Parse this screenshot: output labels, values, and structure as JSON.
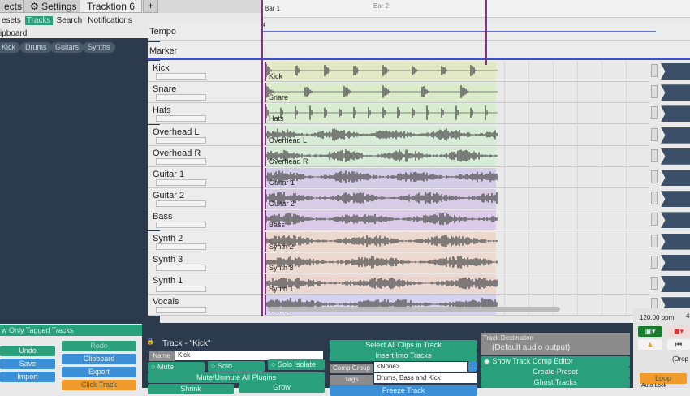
{
  "tabs": [
    {
      "label": "ects"
    },
    {
      "label": "Settings",
      "icon": "gear-icon"
    },
    {
      "label": "Tracktion 6"
    },
    {
      "label": "+"
    }
  ],
  "subnav": [
    "esets",
    "Tracks",
    "Search",
    "Notifications"
  ],
  "clipboard_label": "ipboard",
  "tag_chips": [
    "Kick",
    "Drums",
    "Guitars",
    "Synths"
  ],
  "show_tagged": "w Only Tagged Tracks",
  "timeline": {
    "bar1": "Bar 1",
    "bar2": "Bar 2",
    "tempo": "Tempo",
    "marker": "Marker",
    "sig": "4"
  },
  "tracks": [
    {
      "name": "Kick",
      "color": "#e4e9c5"
    },
    {
      "name": "Snare",
      "color": "#dcebc9"
    },
    {
      "name": "Hats",
      "color": "#d8edcf"
    },
    {
      "name": "Overhead L",
      "color": "#d6ecd6"
    },
    {
      "name": "Overhead R",
      "color": "#d6ecd6"
    },
    {
      "name": "Guitar 1",
      "color": "#d4cde8"
    },
    {
      "name": "Guitar 2",
      "color": "#d8cbe6"
    },
    {
      "name": "Bass",
      "color": "#dccbe8"
    },
    {
      "name": "Synth 2",
      "color": "#ecd8cc"
    },
    {
      "name": "Synth 3",
      "color": "#ecd9cf"
    },
    {
      "name": "Synth 1",
      "color": "#ecd6d0"
    },
    {
      "name": "Vocals",
      "color": "#d6d2ef"
    }
  ],
  "left_buttons": {
    "undo": "Undo",
    "redo": "Redo",
    "save": "Save",
    "clipboard": "Clipboard",
    "import": "Import",
    "export": "Export",
    "click_track": "Click Track"
  },
  "track_panel": {
    "title": "Track - \"Kick\"",
    "name_label": "Name",
    "name_value": "Kick",
    "mute": "Mute",
    "solo": "Solo",
    "solo_isolate": "Solo Isolate",
    "mute_all": "Mute/Unmute All Plugins",
    "grow": "Grow",
    "shrink": "Shrink",
    "select_all": "Select All Clips in Track",
    "insert": "Insert Into Tracks",
    "comp_group_label": "Comp Group",
    "comp_group_value": "<None>",
    "tags_label": "Tags",
    "tags_value": "Drums, Bass and Kick",
    "freeze": "Freeze Track",
    "dest_label": "Track Destination",
    "dest_value": "(Default audio output)",
    "show_comp": "Show Track Comp Editor",
    "create_preset": "Create Preset",
    "ghost": "Ghost Tracks"
  },
  "transport": {
    "bpm": "120.00 bpm",
    "sig": "4",
    "drop": "(Drop",
    "loop": "Loop",
    "autolock": "Auto Lock"
  }
}
